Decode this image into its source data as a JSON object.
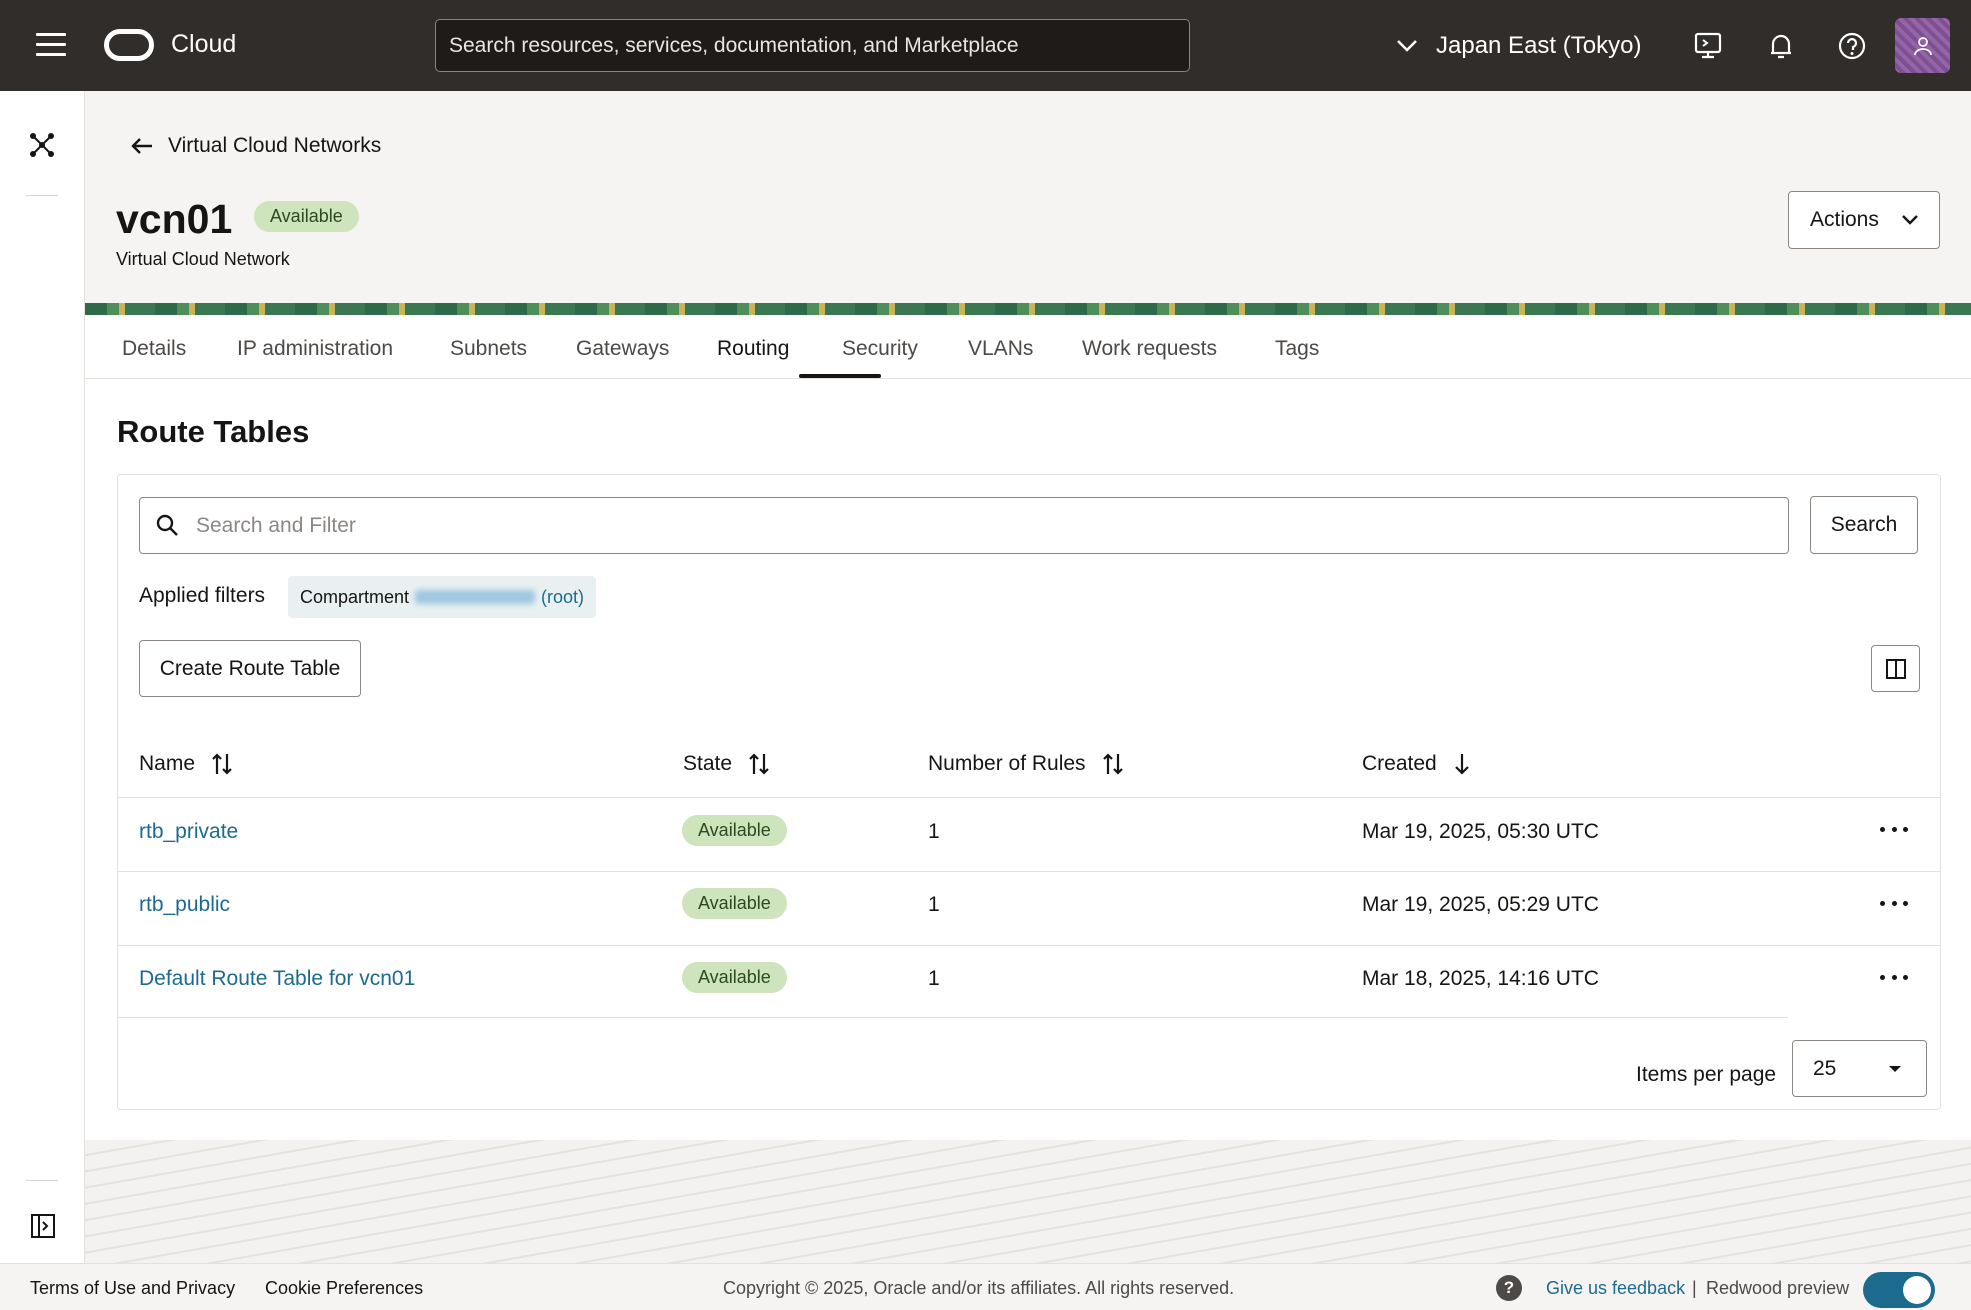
{
  "header": {
    "logo_text": "Cloud",
    "search_placeholder": "Search resources, services, documentation, and Marketplace",
    "region": "Japan East (Tokyo)"
  },
  "breadcrumb": {
    "back_label": "Virtual Cloud Networks"
  },
  "resource": {
    "name": "vcn01",
    "status": "Available",
    "type": "Virtual Cloud Network",
    "actions_label": "Actions"
  },
  "tabs": [
    {
      "label": "Details"
    },
    {
      "label": "IP administration"
    },
    {
      "label": "Subnets"
    },
    {
      "label": "Gateways"
    },
    {
      "label": "Routing"
    },
    {
      "label": "Security"
    },
    {
      "label": "VLANs"
    },
    {
      "label": "Work requests"
    },
    {
      "label": "Tags"
    }
  ],
  "active_tab": "Routing",
  "section": {
    "title": "Route Tables",
    "filter_placeholder": "Search and Filter",
    "search_button": "Search",
    "applied_filters_label": "Applied filters",
    "filter_chip": {
      "label": "Compartment",
      "suffix": "(root)"
    },
    "create_button": "Create Route Table"
  },
  "table": {
    "columns": [
      "Name",
      "State",
      "Number of Rules",
      "Created"
    ],
    "rows": [
      {
        "name": "rtb_private",
        "state": "Available",
        "rules": "1",
        "created": "Mar 19, 2025, 05:30 UTC"
      },
      {
        "name": "rtb_public",
        "state": "Available",
        "rules": "1",
        "created": "Mar 19, 2025, 05:29 UTC"
      },
      {
        "name": "Default Route Table for vcn01",
        "state": "Available",
        "rules": "1",
        "created": "Mar 18, 2025, 14:16 UTC"
      }
    ],
    "items_per_page_label": "Items per page",
    "items_per_page": "25"
  },
  "footer": {
    "terms": "Terms of Use and Privacy",
    "cookies": "Cookie Preferences",
    "copyright": "Copyright © 2025, Oracle and/or its affiliates. All rights reserved.",
    "feedback": "Give us feedback",
    "separator": "|",
    "redwood": "Redwood preview"
  },
  "colors": {
    "header_bg": "#312d2a",
    "link": "#1c6b8e",
    "badge_bg": "#cee4bd",
    "toggle_on": "#1c6b8e"
  }
}
